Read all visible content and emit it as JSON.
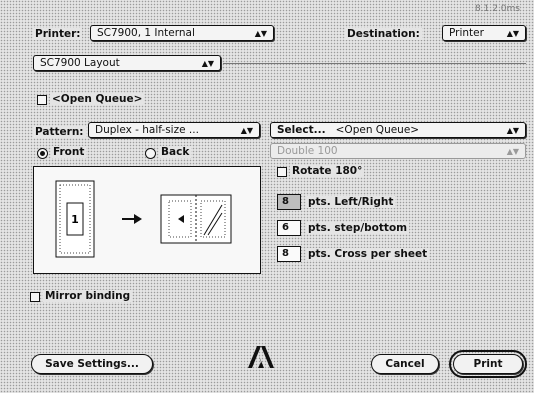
{
  "header": {
    "version": "8.1.2.0ms",
    "printer_label": "Printer:",
    "printer_value": "SC7900, 1 Internal",
    "destination_label": "Destination:",
    "destination_value": "Printer"
  },
  "panel": {
    "value": "SC7900 Layout"
  },
  "open_queue_label": "<Open Queue>",
  "pattern": {
    "label": "Pattern:",
    "value": "Duplex - half-size ..."
  },
  "sides": {
    "front": "Front",
    "back": "Back",
    "selected": "front"
  },
  "select": {
    "label": "Select...",
    "value": "<Open Queue>",
    "secondary": "Double 100"
  },
  "rotate_label": "Rotate 180°",
  "fields": [
    {
      "value": "8",
      "label": "pts. Left/Right"
    },
    {
      "value": "6",
      "label": "pts. step/bottom"
    },
    {
      "value": "8",
      "label": "pts. Cross per sheet"
    }
  ],
  "preview": {
    "page_number": "1"
  },
  "mirror_label": "Mirror binding",
  "buttons": {
    "save": "Save Settings...",
    "cancel": "Cancel",
    "print": "Print"
  }
}
